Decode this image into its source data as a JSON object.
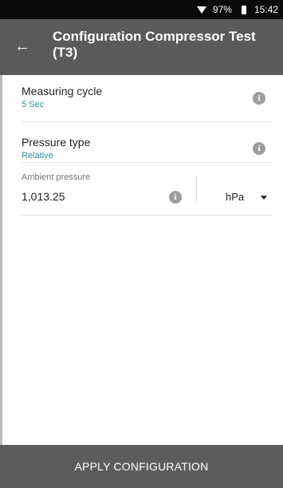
{
  "status_bar": {
    "battery": "97%",
    "time": "15:42",
    "icons": [
      "wifi-icon",
      "battery-icon"
    ]
  },
  "header": {
    "back_icon": "arrow-left-icon",
    "title": "Configuration Compressor Test (T3)"
  },
  "settings": [
    {
      "label": "Measuring cycle",
      "value": "5 Sec",
      "info_icon": "info-icon"
    },
    {
      "label": "Pressure type",
      "value": "Relative",
      "info_icon": "info-icon"
    }
  ],
  "ambient": {
    "label": "Ambient pressure",
    "value": "1,013.25",
    "unit": "hPa",
    "info_icon": "info-icon"
  },
  "footer": {
    "apply_label": "APPLY CONFIGURATION"
  },
  "colors": {
    "appbar": "#5a5a5a",
    "accent_value": "#2f8f9d",
    "statusbar": "#0a0a0a",
    "footer": "#5c5c5c"
  }
}
